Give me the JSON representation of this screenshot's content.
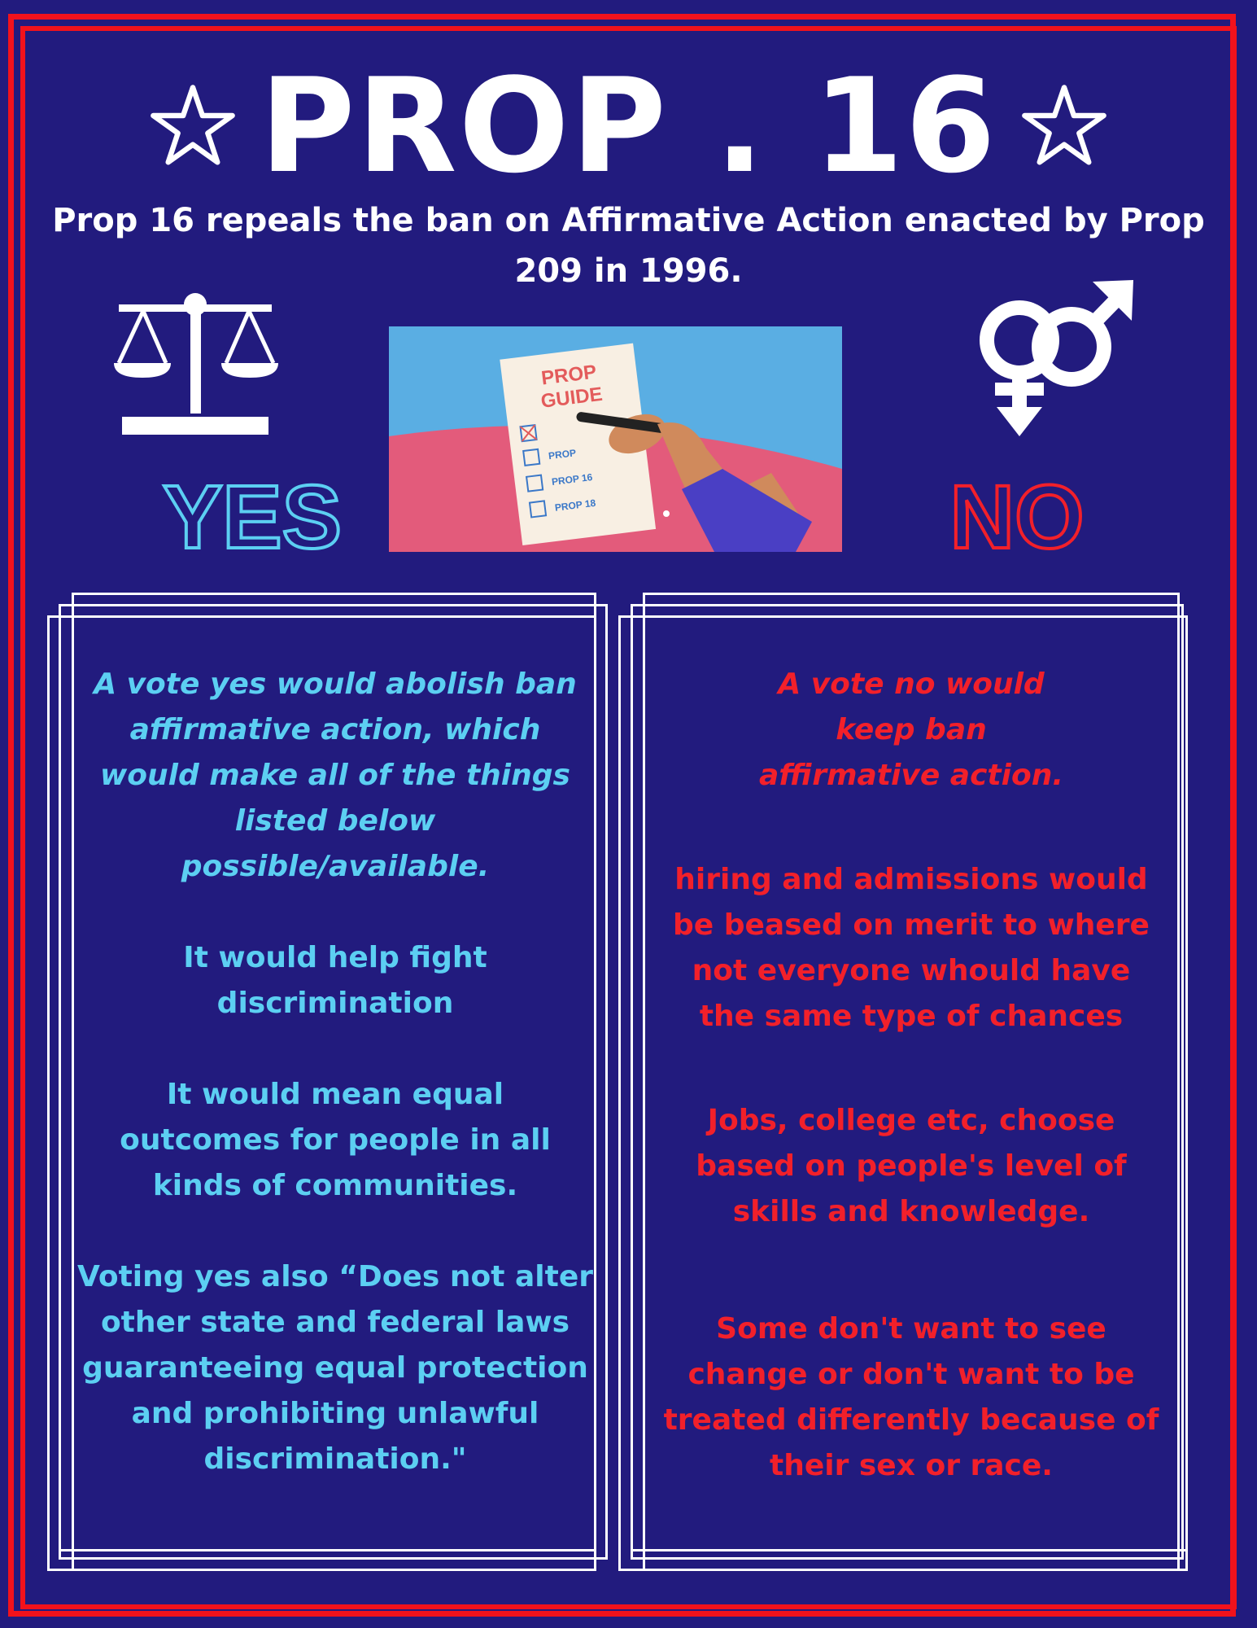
{
  "title": "PROP . 16",
  "subtitle": "Prop 16 repeals the ban on Affirmative Action enacted by Prop 209 in 1996.",
  "icons": {
    "left_star": "star-outline-icon",
    "right_star": "star-outline-icon",
    "scales": "scales-of-justice-icon",
    "gender": "gender-symbols-icon"
  },
  "yes_label": "YES",
  "no_label": "NO",
  "illustration": {
    "card_title_1": "PROP",
    "card_title_2": "GUIDE",
    "items": [
      "PROP",
      "PROP 16",
      "PROP 18"
    ]
  },
  "yes_column": {
    "intro": "A vote yes would abolish ban affirmative action, which would make all of the things listed below possible/available.",
    "points": [
      "It would help fight discrimination",
      "It would mean equal outcomes for people in all kinds of communities.",
      "Voting yes also “Does not alter other state and federal laws guaranteeing equal protection and prohibiting unlawful discrimination.\""
    ]
  },
  "no_column": {
    "intro": "A vote no would keep ban affirmative action.",
    "points": [
      "hiring and admissions would be beased on merit to where not everyone whould have the same type of chances",
      "Jobs, college etc, choose based on people's level of skills and knowledge.",
      "Some don't want to see change or don't want to be treated differently because of their sex or race."
    ]
  },
  "colors": {
    "background": "#221b7e",
    "border_red": "#f2121c",
    "yes_blue": "#5ccff2",
    "no_red": "#f2202a",
    "white": "#ffffff"
  }
}
